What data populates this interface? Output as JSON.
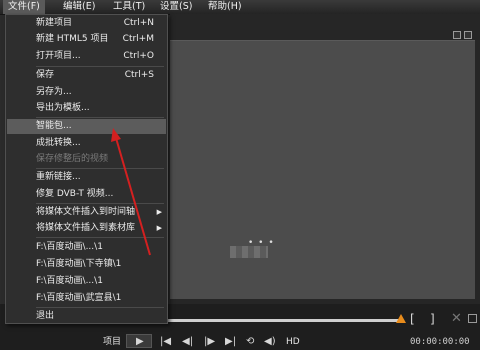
{
  "menubar": {
    "items": [
      {
        "label": "文件(F)"
      },
      {
        "label": "编辑(E)"
      },
      {
        "label": "工具(T)"
      },
      {
        "label": "设置(S)"
      },
      {
        "label": "帮助(H)"
      }
    ]
  },
  "file_menu": {
    "items": [
      {
        "label": "新建项目",
        "shortcut": "Ctrl+N"
      },
      {
        "label": "新建 HTML5 项目",
        "shortcut": "Ctrl+M"
      },
      {
        "label": "打开项目...",
        "shortcut": "Ctrl+O"
      },
      {
        "label": "保存",
        "shortcut": "Ctrl+S"
      },
      {
        "label": "另存为..."
      },
      {
        "label": "导出为模板..."
      },
      {
        "label": "智能包..."
      },
      {
        "label": "成批转换..."
      },
      {
        "label": "保存修整后的视频"
      },
      {
        "label": "重新链接..."
      },
      {
        "label": "修复 DVB-T 视频..."
      },
      {
        "label": "将媒体文件插入到时间轴"
      },
      {
        "label": "将媒体文件插入到素材库"
      },
      {
        "label": "F:\\百度动画\\...\\1"
      },
      {
        "label": "F:\\百度动画\\下寺镇\\1"
      },
      {
        "label": "F:\\百度动画\\...\\1"
      },
      {
        "label": "F:\\百度动画\\武宣县\\1"
      },
      {
        "label": "退出"
      }
    ]
  },
  "preview": {
    "loading": "• • •"
  },
  "playback": {
    "project_label": "项目",
    "hd_label": "HD",
    "timecode": "00:00:00:00"
  },
  "colors": {
    "highlight": "#5c5c5c",
    "accent": "#e88c1c",
    "annotation_arrow": "#d42020"
  },
  "icons": {
    "submenu": "chevron-right-icon",
    "play": "play-icon",
    "volume": "volume-icon",
    "repeat": "repeat-icon"
  }
}
